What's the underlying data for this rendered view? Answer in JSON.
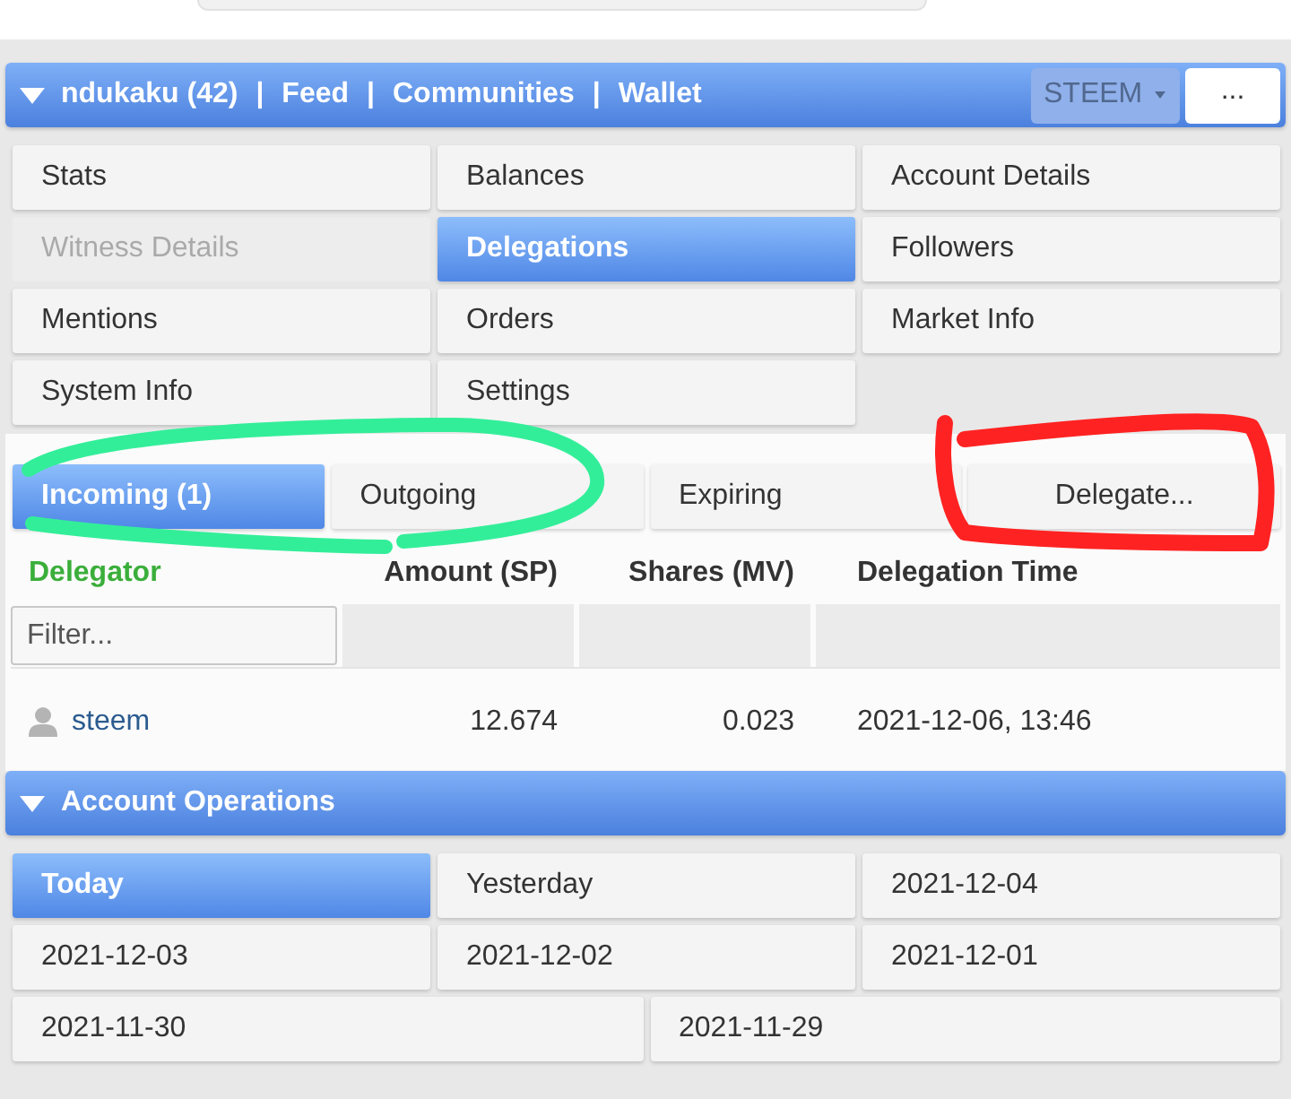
{
  "header": {
    "expanded": true,
    "nav": [
      {
        "label": "ndukaku (42)"
      },
      {
        "label": "Feed"
      },
      {
        "label": "Communities"
      },
      {
        "label": "Wallet"
      }
    ],
    "separators": [
      "|",
      "|",
      "|"
    ],
    "currency": {
      "value": "STEEM"
    },
    "more_button": "..."
  },
  "menu": [
    {
      "label": "Stats",
      "selected": false,
      "disabled": false
    },
    {
      "label": "Balances",
      "selected": false,
      "disabled": false
    },
    {
      "label": "Account Details",
      "selected": false,
      "disabled": false
    },
    {
      "label": "Witness Details",
      "selected": false,
      "disabled": true
    },
    {
      "label": "Delegations",
      "selected": true,
      "disabled": false
    },
    {
      "label": "Followers",
      "selected": false,
      "disabled": false
    },
    {
      "label": "Mentions",
      "selected": false,
      "disabled": false
    },
    {
      "label": "Orders",
      "selected": false,
      "disabled": false
    },
    {
      "label": "Market Info",
      "selected": false,
      "disabled": false
    },
    {
      "label": "System Info",
      "selected": false,
      "disabled": false
    },
    {
      "label": "Settings",
      "selected": false,
      "disabled": false
    }
  ],
  "delegations": {
    "tabs": [
      {
        "label": "Incoming (1)",
        "selected": true
      },
      {
        "label": "Outgoing",
        "selected": false
      },
      {
        "label": "Expiring",
        "selected": false
      }
    ],
    "delegate_button": "Delegate...",
    "table": {
      "columns": [
        {
          "label": "Delegator",
          "sorted": true
        },
        {
          "label": "Amount (SP)",
          "sorted": false
        },
        {
          "label": "Shares (MV)",
          "sorted": false
        },
        {
          "label": "Delegation Time",
          "sorted": false
        }
      ],
      "filter": {
        "placeholder": "Filter..."
      },
      "rows": [
        {
          "delegator": "steem",
          "amount": "12.674",
          "shares": "0.023",
          "time": "2021-12-06, 13:46"
        }
      ]
    }
  },
  "account_operations": {
    "expanded": true,
    "title": "Account Operations",
    "periods": [
      {
        "label": "Today",
        "selected": true
      },
      {
        "label": "Yesterday",
        "selected": false
      },
      {
        "label": "2021-12-04",
        "selected": false
      },
      {
        "label": "2021-12-03",
        "selected": false
      },
      {
        "label": "2021-12-02",
        "selected": false
      },
      {
        "label": "2021-12-01",
        "selected": false
      },
      {
        "label": "2021-11-30",
        "selected": false
      },
      {
        "label": "2021-11-29",
        "selected": false
      }
    ]
  },
  "annotations": [
    {
      "kind": "ellipse",
      "color": "#33ee99"
    },
    {
      "kind": "frame",
      "color": "#ff2222"
    }
  ]
}
